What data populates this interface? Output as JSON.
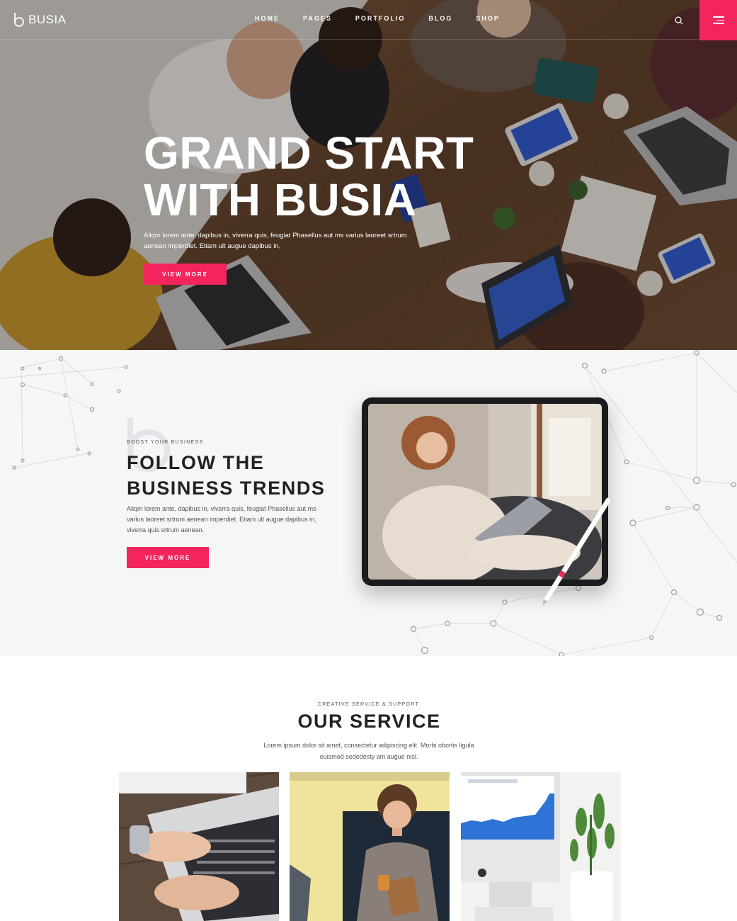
{
  "brand": {
    "name": "BUSIA",
    "accent": "#f3255c"
  },
  "nav": {
    "items": [
      "HOME",
      "PAGES",
      "PORTFOLIO",
      "BLOG",
      "SHOP"
    ],
    "search_icon": "search-icon",
    "menu_icon": "hamburger-icon"
  },
  "hero": {
    "title": "GRAND START WITH BUSIA",
    "text": "Aliqm lorem ante, dapibus in, viverra quis, feugiat Phasellus aut ms varius laoreet srtrum aenean imperdiet. Etiam ult augue dapibus in,",
    "button": "VIEW MORE"
  },
  "trends": {
    "kicker": "BOOST YOUR BUSINESS",
    "title": "FOLLOW THE BUSINESS TRENDS",
    "text": "Aliqm lorem ante, dapibus in, viverra quis, feugiat Phasellus aut ms varius laoreet srtrum aenean imperdiet. Etiam ult augue dapibus in, viverra quis srtrum aenean.",
    "button": "VIEW MORE"
  },
  "service": {
    "kicker": "CREATIVE SERVICE & SUPPORT",
    "title": "OUR SERVICE",
    "text": "Lorem ipsum dolor sit amet, consectetur adipiscing elit. Morbi obortis ligula euismod sededesty am augue nisl."
  }
}
